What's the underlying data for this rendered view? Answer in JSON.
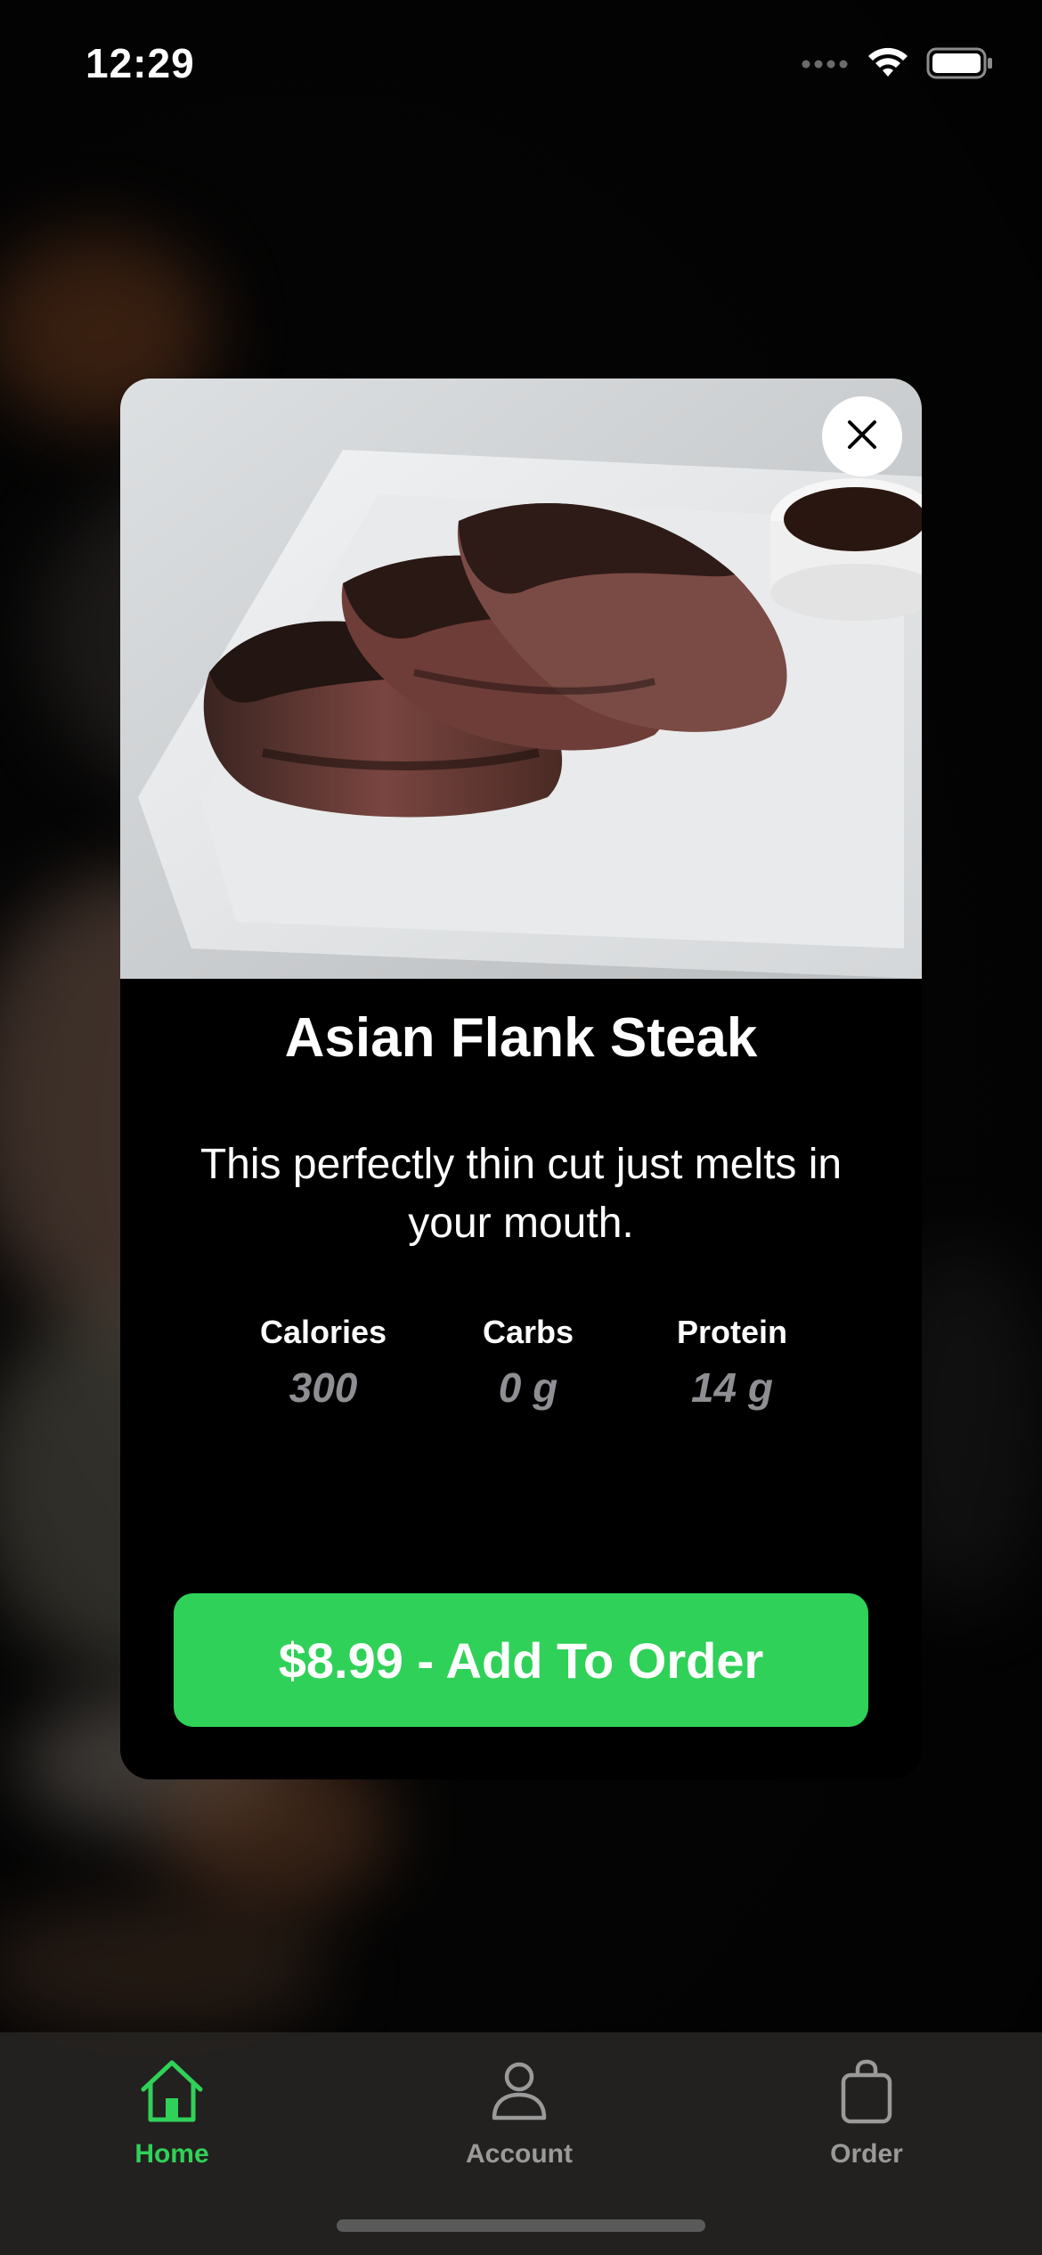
{
  "status_bar": {
    "time": "12:29",
    "icons": [
      "cellular-dots-icon",
      "wifi-icon",
      "battery-icon"
    ]
  },
  "modal": {
    "close_icon": "close-icon",
    "image_alt": "Sliced grilled flank steak on white square plate with dipping sauce",
    "title": "Asian Flank Steak",
    "description": "This perfectly thin cut just melts in your mouth.",
    "nutrition": [
      {
        "label": "Calories",
        "value": "300"
      },
      {
        "label": "Carbs",
        "value": "0 g"
      },
      {
        "label": "Protein",
        "value": "14 g"
      }
    ],
    "add_button_label": "$8.99 - Add To Order"
  },
  "tab_bar": {
    "tabs": [
      {
        "label": "Home",
        "icon": "home-icon",
        "active": true
      },
      {
        "label": "Account",
        "icon": "person-icon",
        "active": false
      },
      {
        "label": "Order",
        "icon": "shopping-bag-icon",
        "active": false
      }
    ]
  },
  "colors": {
    "accent": "#30d158",
    "modal_bg": "#000000",
    "muted_text": "#8e8e93",
    "tab_inactive": "#9a9a9a"
  }
}
